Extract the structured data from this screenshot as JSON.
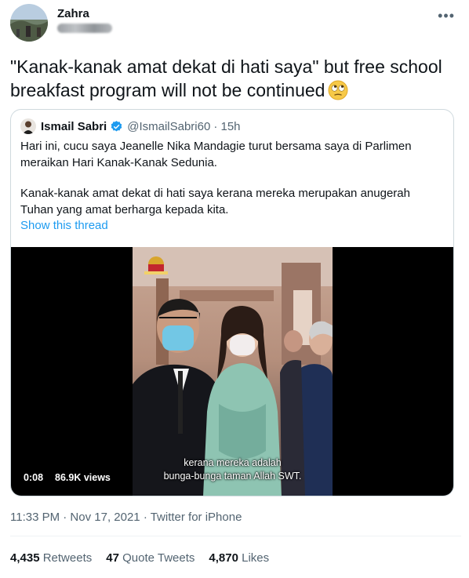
{
  "author": {
    "name": "Zahra"
  },
  "tweet": {
    "text": "\"Kanak-kanak amat dekat di hati saya\" but free school breakfast program will not be continued",
    "emoji": "face-with-rolling-eyes",
    "timestamp": "11:33 PM · Nov 17, 2021 · Twitter for iPhone"
  },
  "quoted": {
    "name": "Ismail Sabri",
    "handle": "@IsmailSabri60",
    "time": "· 15h",
    "paragraph1": "Hari ini, cucu saya Jeanelle Nika Mandagie turut bersama saya di Parlimen meraikan Hari Kanak-Kanak Sedunia.",
    "paragraph2": "Kanak-kanak amat dekat di hati saya kerana mereka merupakan anugerah Tuhan yang amat berharga kepada kita.",
    "show_thread": "Show this thread",
    "video": {
      "caption_line1": "kerana mereka adalah",
      "caption_line2": "bunga-bunga taman Allah SWT.",
      "duration": "0:08",
      "views": "86.9K views"
    }
  },
  "stats": {
    "retweets_count": "4,435",
    "retweets_label": "Retweets",
    "quotes_count": "47",
    "quotes_label": "Quote Tweets",
    "likes_count": "4,870",
    "likes_label": "Likes"
  },
  "colors": {
    "accent": "#1d9bf0",
    "secondary_text": "#536471",
    "border": "#cfd9de"
  }
}
